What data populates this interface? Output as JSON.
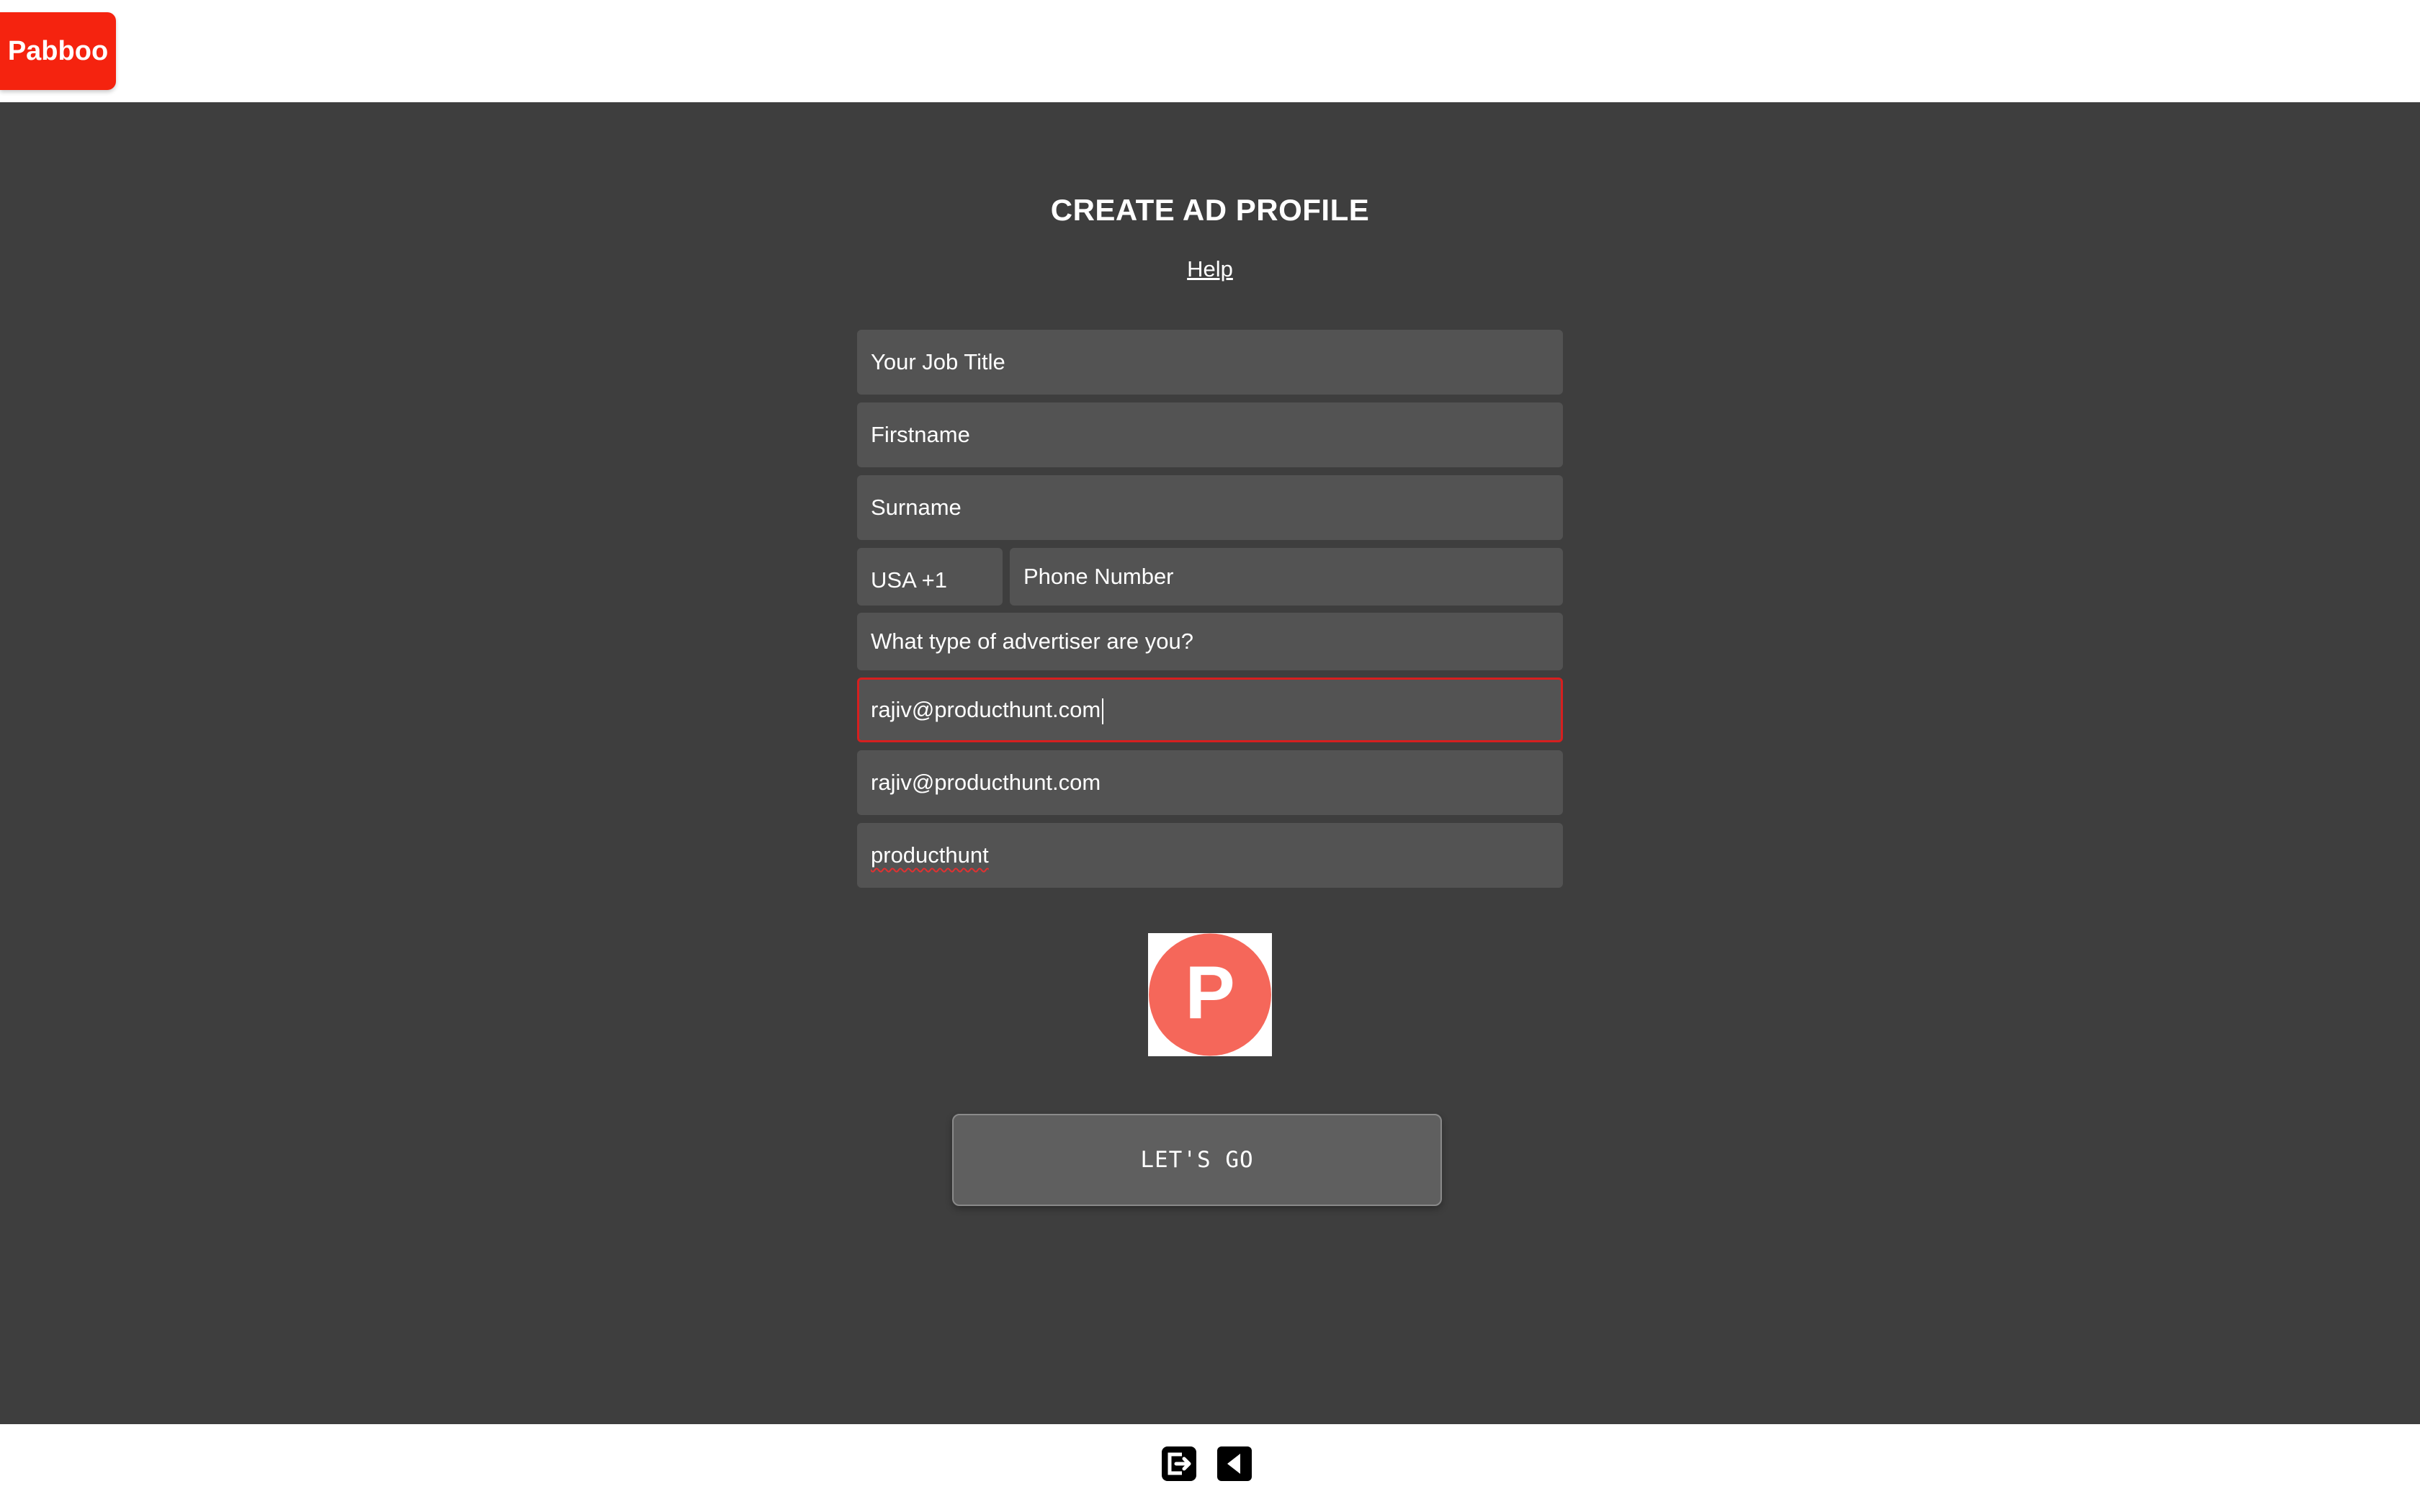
{
  "brand": {
    "logo_text": "Pabboo",
    "accent_color": "#f5230f"
  },
  "page": {
    "title": "CREATE AD PROFILE",
    "help_link": "Help"
  },
  "form": {
    "job_title_placeholder": "Your Job Title",
    "firstname_placeholder": "Firstname",
    "surname_placeholder": "Surname",
    "country_code_value": "USA +1",
    "phone_placeholder": "Phone Number",
    "advertiser_type_placeholder": "What type of advertiser are you?",
    "email_value": "rajiv@producthunt.com",
    "email_confirm_value": "rajiv@producthunt.com",
    "company_value": "producthunt",
    "focused_border_color": "#d61f1f",
    "company_logo_letter": "P",
    "company_logo_color": "#f5675a",
    "submit_label": "LET'S GO"
  },
  "footer": {
    "icons": [
      "logout-icon",
      "back-icon"
    ]
  }
}
